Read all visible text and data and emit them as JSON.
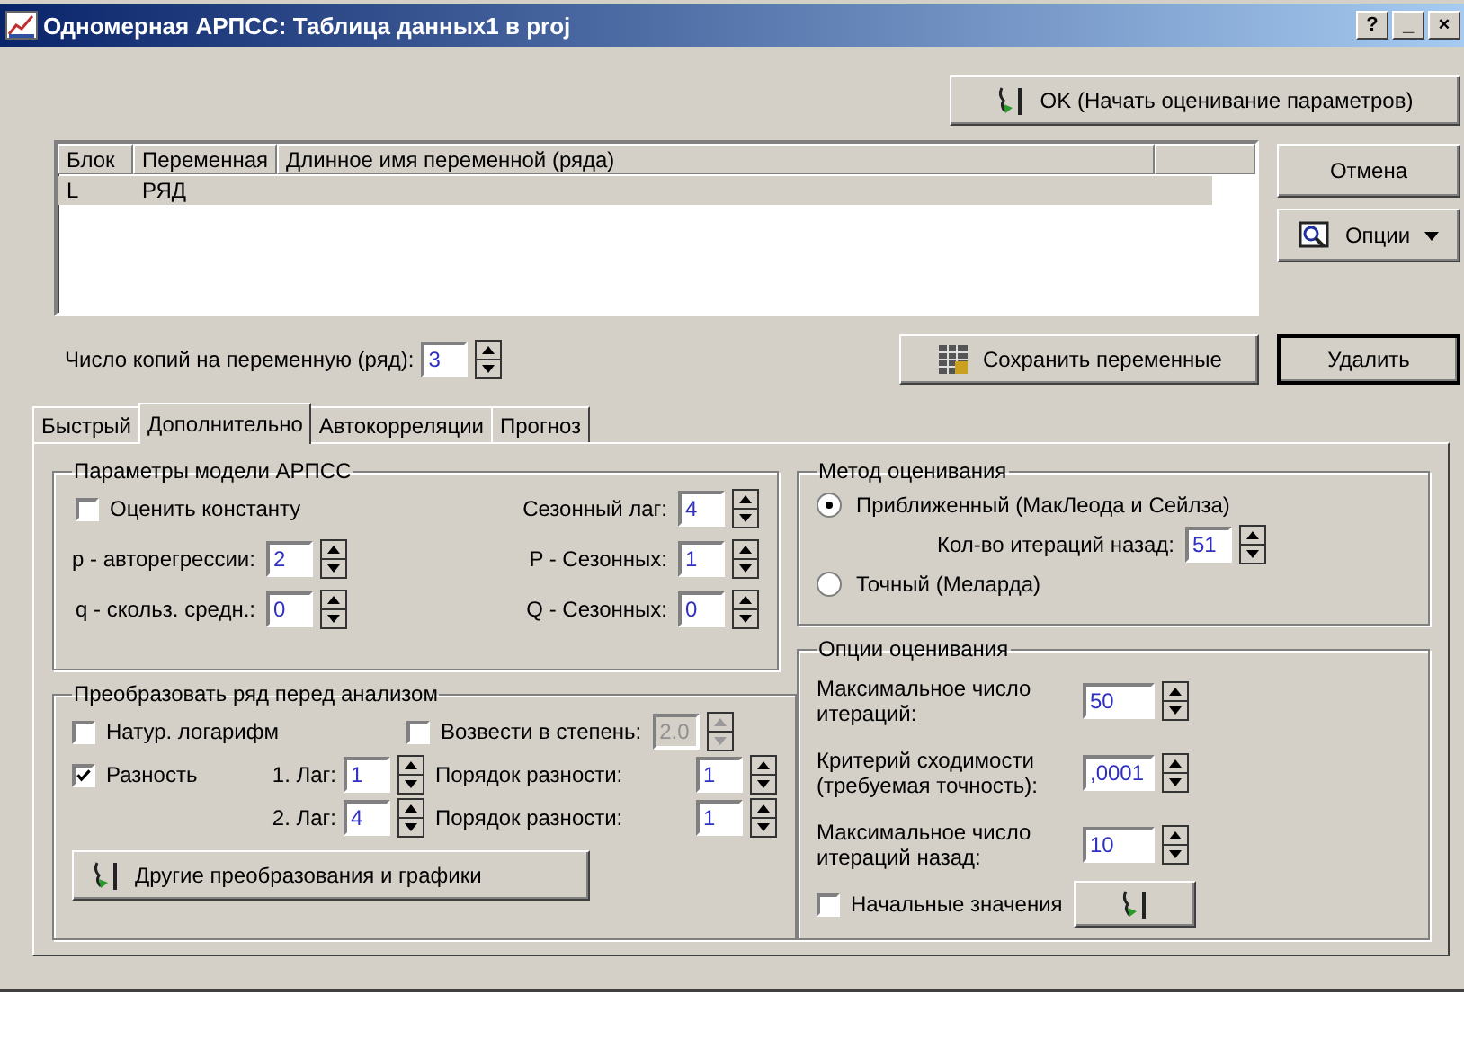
{
  "window": {
    "title": "Одномерная АРПСС: Таблица данных1 в proj",
    "controls": [
      "?",
      "_",
      "×"
    ]
  },
  "ok_button": "OK (Начать оценивание параметров)",
  "variables": {
    "columns": [
      "Блок",
      "Переменная",
      "Длинное имя переменной (ряда)"
    ],
    "rows": [
      {
        "cells": [
          "L",
          "РЯД"
        ],
        "selected": true
      }
    ]
  },
  "side_buttons": [
    {
      "label": "Отмена",
      "kind": "plain"
    },
    {
      "label": "Опции",
      "kind": "menu"
    }
  ],
  "copies": {
    "label": "Число копий на переменную (ряд):",
    "value": "3"
  },
  "save_button": "Сохранить переменные",
  "delete_button": "Удалить",
  "tabs": [
    {
      "label": "Быстрый",
      "selected": false
    },
    {
      "label": "Дополнительно",
      "selected": true
    },
    {
      "label": "Автокорреляции",
      "selected": false
    },
    {
      "label": "Прогноз",
      "selected": false
    }
  ],
  "arima_group": {
    "title": "Параметры модели АРПСС",
    "constant": {
      "label": "Оценить константу",
      "checked": false
    },
    "left_fields": [
      {
        "label": "p - авторегрессии:",
        "value": "2"
      },
      {
        "label": "q - скольз. средн.:",
        "value": "0"
      }
    ],
    "right_fields": [
      {
        "label": "Сезонный лаг:",
        "value": "4"
      },
      {
        "label": "P - Сезонных:",
        "value": "1"
      },
      {
        "label": "Q - Сезонных:",
        "value": "0"
      }
    ]
  },
  "transform_group": {
    "title": "Преобразовать ряд перед анализом",
    "log": {
      "label": "Натур. логарифм",
      "checked": false
    },
    "power": {
      "label": "Возвести в степень:",
      "checked": false,
      "value": "2.0",
      "disabled": true
    },
    "difference": {
      "label": "Разность",
      "checked": true
    },
    "lags": [
      {
        "label": "1. Лаг:",
        "value": "1",
        "order_label": "Порядок разности:",
        "order_value": "1"
      },
      {
        "label": "2. Лаг:",
        "value": "4",
        "order_label": "Порядок разности:",
        "order_value": "1"
      }
    ],
    "button": "Другие преобразования и графики"
  },
  "method_group": {
    "title": "Метод оценивания",
    "options": [
      {
        "label": "Приближенный (МакЛеода и Сейлза)",
        "selected": true
      },
      {
        "label": "Точный (Меларда)",
        "selected": false
      }
    ],
    "iterations": {
      "label": "Кол-во итераций назад:",
      "value": "51"
    }
  },
  "options_group": {
    "title": "Опции оценивания",
    "fields": [
      {
        "label": "Максимальное число итераций:",
        "value": "50"
      },
      {
        "label": "Критерий сходимости (требуемая точность):",
        "value": ",0001"
      },
      {
        "label": "Максимальное число итераций назад:",
        "value": "10"
      }
    ],
    "initial": {
      "label": "Начальные значения",
      "checked": false
    }
  }
}
